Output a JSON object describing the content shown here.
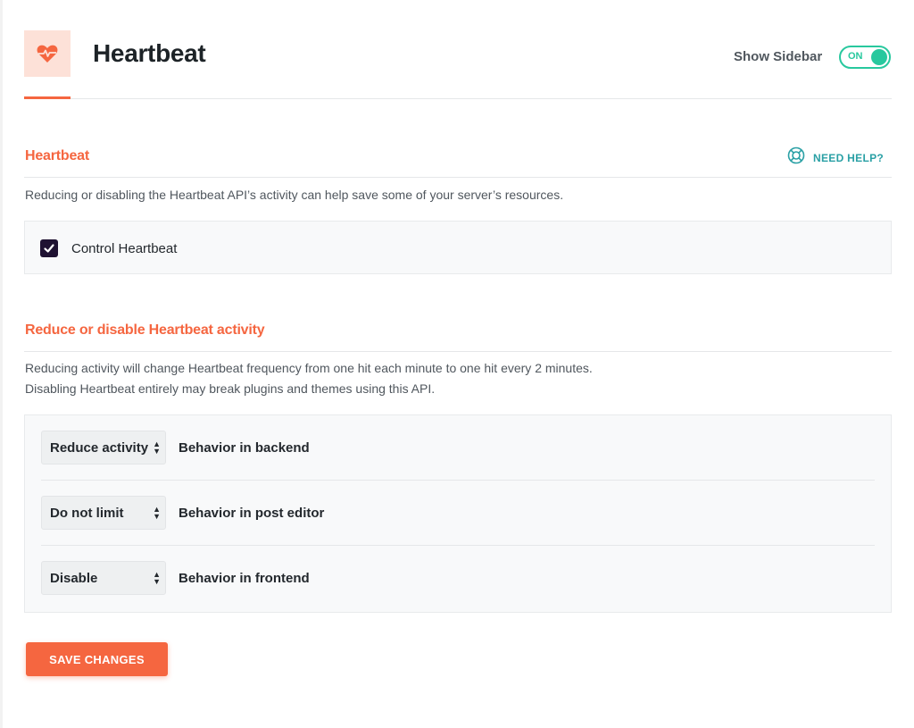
{
  "header": {
    "title": "Heartbeat",
    "icon": "heartbeat-icon",
    "sidebar_toggle": {
      "label": "Show Sidebar",
      "state_text": "ON",
      "on": true
    }
  },
  "colors": {
    "accent": "#f56640",
    "accent_light": "#fde1d8",
    "toggle_on": "#28c89e",
    "help": "#2aa0a5",
    "checkbox": "#1f1232"
  },
  "heartbeat_section": {
    "title": "Heartbeat",
    "help_label": "NEED HELP?",
    "help_icon": "lifebuoy-icon",
    "description": "Reducing or disabling the Heartbeat API’s activity can help save some of your server’s resources.",
    "control": {
      "label": "Control Heartbeat",
      "checked": true
    }
  },
  "activity_section": {
    "title": "Reduce or disable Heartbeat activity",
    "description_lines": [
      "Reducing activity will change Heartbeat frequency from one hit each minute to one hit every 2 minutes.",
      "Disabling Heartbeat entirely may break plugins and themes using this API."
    ],
    "behaviors": [
      {
        "selected": "Reduce activity",
        "label": "Behavior in backend"
      },
      {
        "selected": "Do not limit",
        "label": "Behavior in post editor"
      },
      {
        "selected": "Disable",
        "label": "Behavior in frontend"
      }
    ]
  },
  "footer": {
    "save_label": "SAVE CHANGES"
  }
}
